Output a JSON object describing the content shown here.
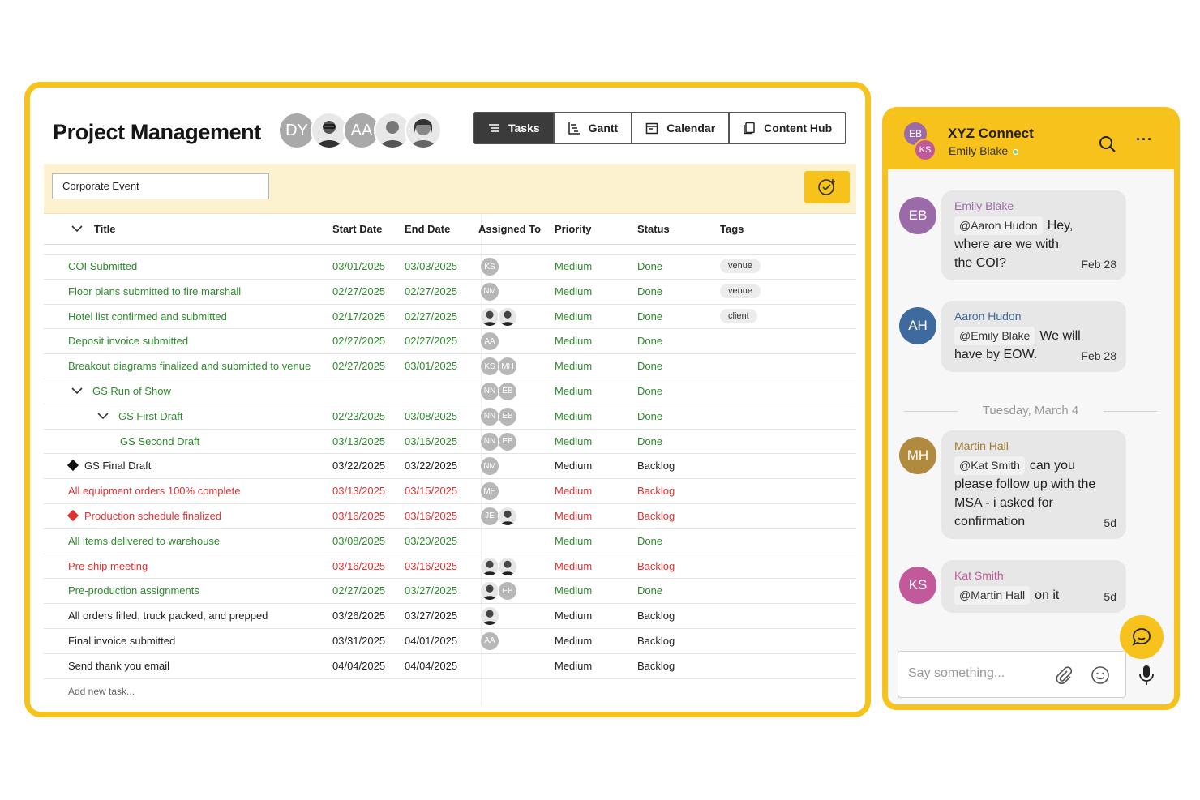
{
  "project": {
    "title": "Project Management",
    "team_avatars": [
      {
        "initials": "DY",
        "kind": "initials"
      },
      {
        "initials": "",
        "kind": "photo"
      },
      {
        "initials": "AA",
        "kind": "initials"
      },
      {
        "initials": "",
        "kind": "photo"
      },
      {
        "initials": "",
        "kind": "photo"
      }
    ],
    "views": [
      {
        "label": "Tasks",
        "icon": "list-icon",
        "active": true
      },
      {
        "label": "Gantt",
        "icon": "gantt-icon",
        "active": false
      },
      {
        "label": "Calendar",
        "icon": "calendar-icon",
        "active": false
      },
      {
        "label": "Content Hub",
        "icon": "document-icon",
        "active": false
      }
    ],
    "project_select": "Corporate Event",
    "columns": {
      "title": "Title",
      "start": "Start Date",
      "end": "End Date",
      "assigned": "Assigned To",
      "priority": "Priority",
      "status": "Status",
      "tags": "Tags"
    },
    "rows": [
      {
        "title": "COI Submitted",
        "start": "03/01/2025",
        "end": "03/03/2025",
        "assignees": [
          "KS"
        ],
        "priority": "Medium",
        "status": "Done",
        "tag": "venue",
        "color": "green",
        "indent": 0,
        "marker": ""
      },
      {
        "title": "Floor plans submitted to fire marshall",
        "start": "02/27/2025",
        "end": "02/27/2025",
        "assignees": [
          "NM"
        ],
        "priority": "Medium",
        "status": "Done",
        "tag": "venue",
        "color": "green",
        "indent": 0,
        "marker": ""
      },
      {
        "title": "Hotel list confirmed and submitted",
        "start": "02/17/2025",
        "end": "02/27/2025",
        "assignees": [
          "photo",
          "photo"
        ],
        "priority": "Medium",
        "status": "Done",
        "tag": "client",
        "color": "green",
        "indent": 0,
        "marker": ""
      },
      {
        "title": "Deposit invoice submitted",
        "start": "02/27/2025",
        "end": "02/27/2025",
        "assignees": [
          "AA"
        ],
        "priority": "Medium",
        "status": "Done",
        "tag": "",
        "color": "green",
        "indent": 0,
        "marker": ""
      },
      {
        "title": "Breakout diagrams finalized and submitted to venue",
        "start": "02/27/2025",
        "end": "03/01/2025",
        "assignees": [
          "KS",
          "MH"
        ],
        "priority": "Medium",
        "status": "Done",
        "tag": "",
        "color": "green",
        "indent": 0,
        "marker": ""
      },
      {
        "title": "GS Run of Show",
        "start": "",
        "end": "",
        "assignees": [
          "NN",
          "EB"
        ],
        "priority": "Medium",
        "status": "Done",
        "tag": "",
        "color": "green",
        "indent": 1,
        "marker": "chevron"
      },
      {
        "title": "GS First Draft",
        "start": "02/23/2025",
        "end": "03/08/2025",
        "assignees": [
          "NN",
          "EB"
        ],
        "priority": "Medium",
        "status": "Done",
        "tag": "",
        "color": "green",
        "indent": 2,
        "marker": "chevron"
      },
      {
        "title": "GS Second Draft",
        "start": "03/13/2025",
        "end": "03/16/2025",
        "assignees": [
          "NN",
          "EB"
        ],
        "priority": "Medium",
        "status": "Done",
        "tag": "",
        "color": "green",
        "indent": 3,
        "marker": ""
      },
      {
        "title": "GS Final Draft",
        "start": "03/22/2025",
        "end": "03/22/2025",
        "assignees": [
          "NM"
        ],
        "priority": "Medium",
        "status": "Backlog",
        "tag": "",
        "color": "black",
        "indent": 0,
        "marker": "diamond-black"
      },
      {
        "title": "All equipment orders 100% complete",
        "start": "03/13/2025",
        "end": "03/15/2025",
        "assignees": [
          "MH"
        ],
        "priority": "Medium",
        "status": "Backlog",
        "tag": "",
        "color": "red",
        "indent": 0,
        "marker": ""
      },
      {
        "title": "Production schedule finalized",
        "start": "03/16/2025",
        "end": "03/16/2025",
        "assignees": [
          "JE",
          "photo"
        ],
        "priority": "Medium",
        "status": "Backlog",
        "tag": "",
        "color": "red",
        "indent": 0,
        "marker": "diamond-red"
      },
      {
        "title": "All items delivered to warehouse",
        "start": "03/08/2025",
        "end": "03/20/2025",
        "assignees": [],
        "priority": "Medium",
        "status": "Done",
        "tag": "",
        "color": "green",
        "indent": 0,
        "marker": ""
      },
      {
        "title": "Pre-ship meeting",
        "start": "03/16/2025",
        "end": "03/16/2025",
        "assignees": [
          "photo",
          "photo"
        ],
        "priority": "Medium",
        "status": "Backlog",
        "tag": "",
        "color": "red",
        "indent": 0,
        "marker": ""
      },
      {
        "title": "Pre-production assignments",
        "start": "02/27/2025",
        "end": "03/27/2025",
        "assignees": [
          "photo",
          "EB"
        ],
        "priority": "Medium",
        "status": "Done",
        "tag": "",
        "color": "green",
        "indent": 0,
        "marker": ""
      },
      {
        "title": "All orders filled, truck packed, and prepped",
        "start": "03/26/2025",
        "end": "03/27/2025",
        "assignees": [
          "photo"
        ],
        "priority": "Medium",
        "status": "Backlog",
        "tag": "",
        "color": "black",
        "indent": 0,
        "marker": ""
      },
      {
        "title": "Final invoice submitted",
        "start": "03/31/2025",
        "end": "04/01/2025",
        "assignees": [
          "AA"
        ],
        "priority": "Medium",
        "status": "Backlog",
        "tag": "",
        "color": "black",
        "indent": 0,
        "marker": ""
      },
      {
        "title": "Send thank you email",
        "start": "04/04/2025",
        "end": "04/04/2025",
        "assignees": [],
        "priority": "Medium",
        "status": "Backlog",
        "tag": "",
        "color": "black",
        "indent": 0,
        "marker": ""
      }
    ],
    "add_task_label": "Add new task..."
  },
  "chat": {
    "title": "XYZ Connect",
    "subtitle": "Emily Blake",
    "header_avatars": [
      "EB",
      "KS"
    ],
    "messages": [
      {
        "initials": "EB",
        "author": "Emily Blake",
        "mention": "@Aaron Hudon",
        "text_lines": [
          "Hey,",
          "where are we with",
          "the COI?"
        ],
        "time": "Feb 28",
        "avatar_color": "#9b6aa8",
        "author_color": "#9b6aa8"
      },
      {
        "initials": "AH",
        "author": "Aaron Hudon",
        "mention": "@Emily Blake",
        "text_lines": [
          "We will",
          "have by EOW."
        ],
        "time": "Feb 28",
        "avatar_color": "#3f6a9e",
        "author_color": "#3f6a9e"
      },
      {
        "initials": "MH",
        "author": "Martin Hall",
        "mention": "@Kat Smith",
        "text_lines": [
          "can you",
          "please follow up with the",
          "MSA - i asked for",
          "confirmation"
        ],
        "time": "5d",
        "avatar_color": "#b08a3e",
        "author_color": "#a07a2e"
      },
      {
        "initials": "KS",
        "author": "Kat Smith",
        "mention": "@Martin Hall",
        "text_lines": [
          "on it"
        ],
        "time": "5d",
        "avatar_color": "#c2599a",
        "author_color": "#c2599a"
      }
    ],
    "day_separator": "Tuesday, March 4",
    "composer_placeholder": "Say something..."
  },
  "colors": {
    "accent": "#f7c21b",
    "done_green": "#2e8b2e",
    "overdue_red": "#e03131",
    "toolbar_bg": "#fdf2cf"
  }
}
